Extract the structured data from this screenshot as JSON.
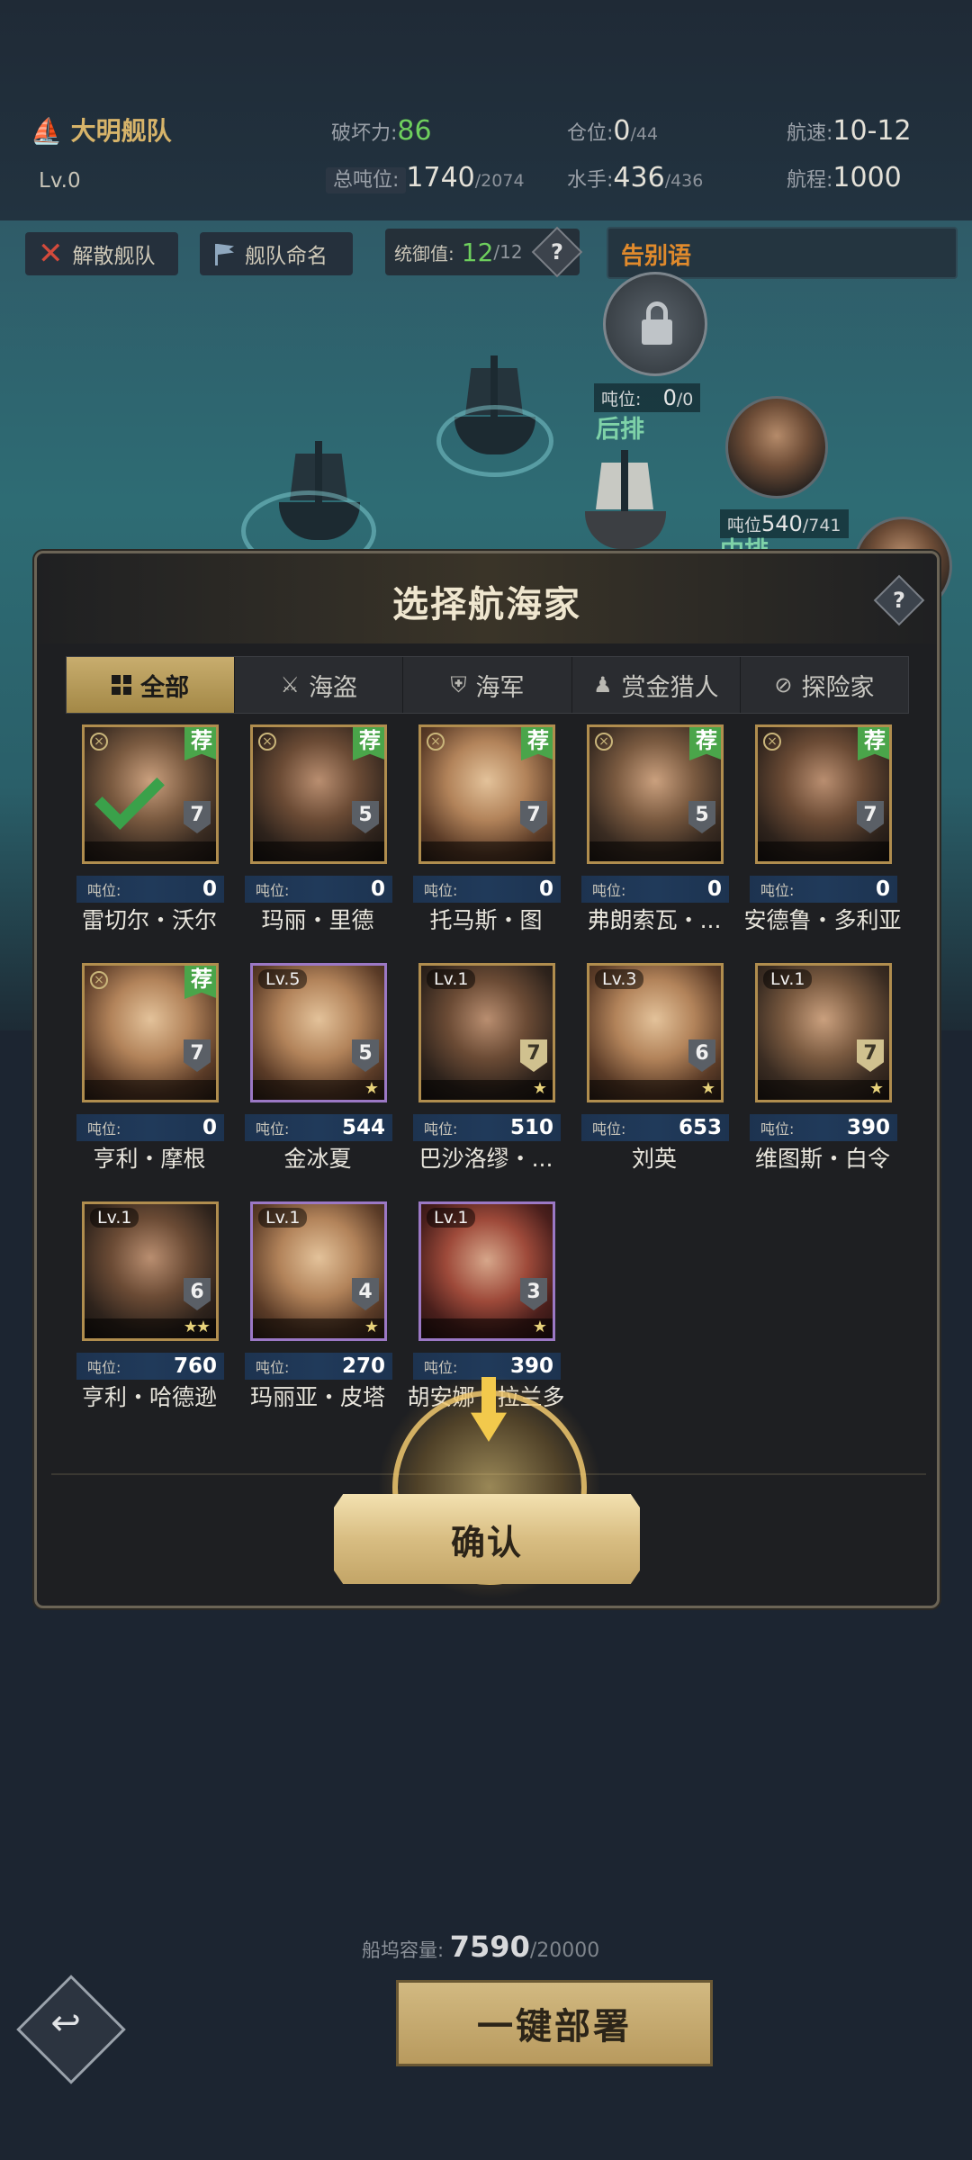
{
  "fleet": {
    "name": "大明舰队",
    "level": "Lv.0"
  },
  "stats": {
    "damage_label": "破坏力:",
    "damage_value": "86",
    "hold_label": "仓位:",
    "hold_value": "0",
    "hold_max": "/44",
    "speed_label": "航速:",
    "speed_value": "10-12",
    "tonnage_label": "总吨位:",
    "tonnage_value": "1740",
    "tonnage_max": "/2074",
    "crew_label": "水手:",
    "crew_value": "436",
    "crew_max": "/436",
    "range_label": "航程:",
    "range_value": "1000"
  },
  "actions": {
    "disband": "解散舰队",
    "rename": "舰队命名"
  },
  "command": {
    "label": "统御值:",
    "value": "12",
    "max": "/12",
    "help": "?"
  },
  "farewell": "告别语",
  "formation": {
    "back_tonnage_label": "吨位:",
    "back_tonnage_value": "0",
    "back_tonnage_max": "/0",
    "back_label": "后排",
    "mid_tonnage_label": "吨位",
    "mid_tonnage_value": "540",
    "mid_tonnage_max": "/741",
    "mid_label": "中排"
  },
  "modal": {
    "title": "选择航海家",
    "help": "?",
    "tabs": [
      "全部",
      "海盗",
      "海军",
      "赏金猎人",
      "探险家"
    ],
    "tab_icons": [
      "grid-icon",
      "crossed-swords-icon",
      "shield-icon",
      "hunter-icon",
      "compass-icon"
    ],
    "stat_label": "吨位:",
    "recommend": "荐",
    "navigators": [
      {
        "name": "雷切尔・沃尔",
        "tonnage": "0",
        "grade": "7",
        "level": "",
        "rec": true,
        "selected": true,
        "stars": "",
        "frame": "gold"
      },
      {
        "name": "玛丽・里德",
        "tonnage": "0",
        "grade": "5",
        "level": "",
        "rec": true,
        "selected": false,
        "stars": "",
        "frame": "gold"
      },
      {
        "name": "托马斯・图",
        "tonnage": "0",
        "grade": "7",
        "level": "",
        "rec": true,
        "selected": false,
        "stars": "",
        "frame": "gold"
      },
      {
        "name": "弗朗索瓦・...",
        "tonnage": "0",
        "grade": "5",
        "level": "",
        "rec": true,
        "selected": false,
        "stars": "",
        "frame": "gold"
      },
      {
        "name": "安德鲁・多利亚",
        "tonnage": "0",
        "grade": "7",
        "level": "",
        "rec": true,
        "selected": false,
        "stars": "",
        "frame": "gold"
      },
      {
        "name": "亨利・摩根",
        "tonnage": "0",
        "grade": "7",
        "level": "",
        "rec": true,
        "selected": false,
        "stars": "",
        "frame": "gold"
      },
      {
        "name": "金冰夏",
        "tonnage": "544",
        "grade": "5",
        "level": "Lv.5",
        "rec": false,
        "selected": false,
        "stars": "★",
        "frame": "purple"
      },
      {
        "name": "巴沙洛缪・...",
        "tonnage": "510",
        "grade": "7",
        "level": "Lv.1",
        "rec": false,
        "selected": false,
        "stars": "★",
        "frame": "gold"
      },
      {
        "name": "刘英",
        "tonnage": "653",
        "grade": "6",
        "level": "Lv.3",
        "rec": false,
        "selected": false,
        "stars": "★",
        "frame": "gold"
      },
      {
        "name": "维图斯・白令",
        "tonnage": "390",
        "grade": "7",
        "level": "Lv.1",
        "rec": false,
        "selected": false,
        "stars": "★",
        "frame": "gold"
      },
      {
        "name": "亨利・哈德逊",
        "tonnage": "760",
        "grade": "6",
        "level": "Lv.1",
        "rec": false,
        "selected": false,
        "stars": "★★",
        "frame": "gold"
      },
      {
        "name": "玛丽亚・皮塔",
        "tonnage": "270",
        "grade": "4",
        "level": "Lv.1",
        "rec": false,
        "selected": false,
        "stars": "★",
        "frame": "purple"
      },
      {
        "name": "胡安娜・拉兰多",
        "tonnage": "390",
        "grade": "3",
        "level": "Lv.1",
        "rec": false,
        "selected": false,
        "stars": "★",
        "frame": "purple"
      }
    ],
    "confirm": "确认"
  },
  "dock": {
    "label": "船坞容量:",
    "value": "7590",
    "max": "/20000"
  },
  "deploy": "一键部署",
  "back_icon": "return-arrow-icon",
  "colors": {
    "accent_gold": "#c8ad6e",
    "green_value": "#6ecf5d",
    "recommend_green": "#4aa54a",
    "purple_frame": "#9b78c5"
  }
}
